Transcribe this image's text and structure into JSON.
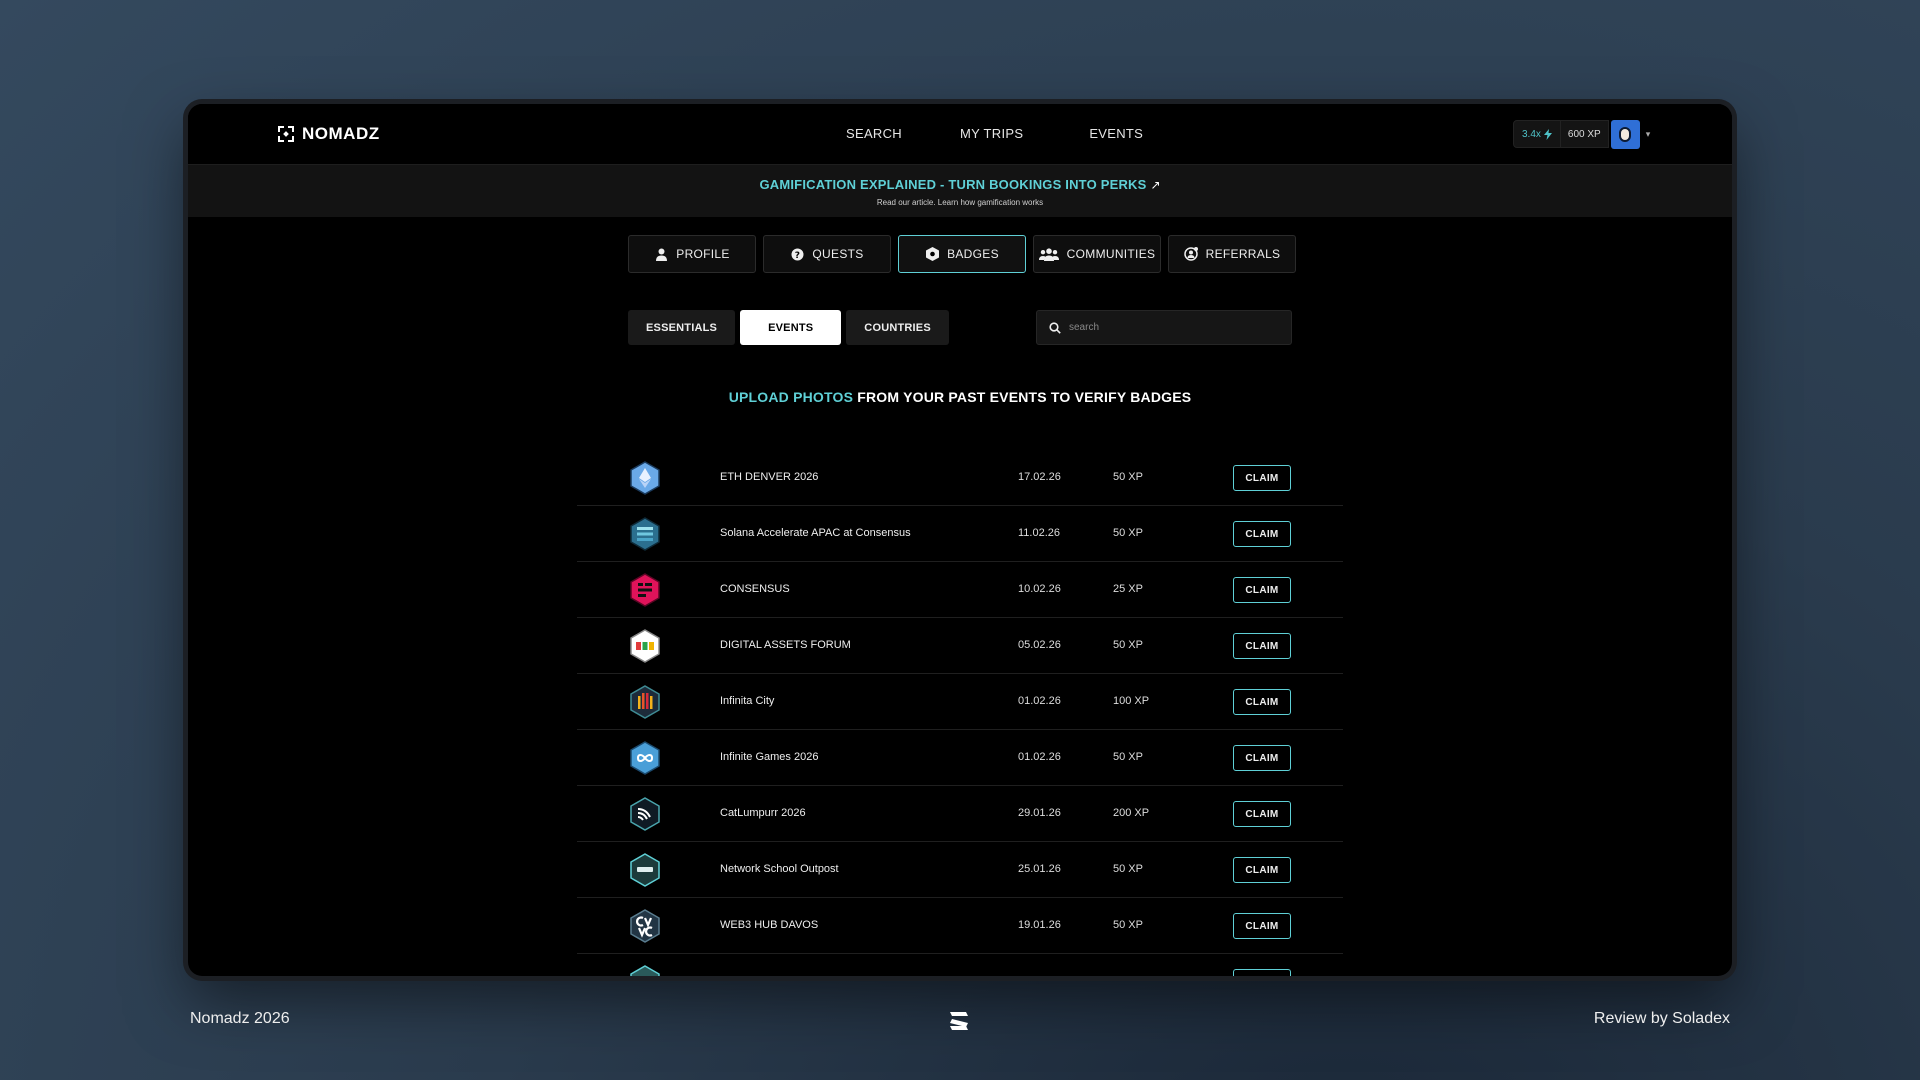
{
  "app": {
    "logo_text": "NOMADZ"
  },
  "nav": {
    "items": [
      {
        "label": "SEARCH"
      },
      {
        "label": "MY TRIPS"
      },
      {
        "label": "EVENTS"
      }
    ]
  },
  "user": {
    "multiplier": "3.4x",
    "xp": "600 XP"
  },
  "banner": {
    "title": "GAMIFICATION EXPLAINED - TURN BOOKINGS INTO PERKS",
    "subtitle": "Read our article. Learn how gamification works"
  },
  "tabs": [
    {
      "label": "PROFILE",
      "icon": "person-icon",
      "active": false
    },
    {
      "label": "QUESTS",
      "icon": "quest-icon",
      "active": false
    },
    {
      "label": "BADGES",
      "icon": "badge-icon",
      "active": true
    },
    {
      "label": "COMMUNITIES",
      "icon": "users-icon",
      "active": false
    },
    {
      "label": "REFERRALS",
      "icon": "referral-icon",
      "active": false
    }
  ],
  "subtabs": [
    {
      "label": "ESSENTIALS",
      "active": false
    },
    {
      "label": "EVENTS",
      "active": true
    },
    {
      "label": "COUNTRIES",
      "active": false
    }
  ],
  "search": {
    "placeholder": "search"
  },
  "headline": {
    "accent": "UPLOAD PHOTOS",
    "rest": " FROM YOUR PAST EVENTS TO VERIFY BADGES"
  },
  "events": [
    {
      "name": "ETH DENVER 2026",
      "date": "17.02.26",
      "xp": "50 XP",
      "action": "CLAIM",
      "badge_color": "#6aa9e8",
      "badge_icon": "eth-denver-badge-icon"
    },
    {
      "name": "Solana Accelerate APAC at Consensus",
      "date": "11.02.26",
      "xp": "50 XP",
      "action": "CLAIM",
      "badge_color": "#2b6f8f",
      "badge_icon": "solana-badge-icon"
    },
    {
      "name": "CONSENSUS",
      "date": "10.02.26",
      "xp": "25 XP",
      "action": "CLAIM",
      "badge_color": "#e0135a",
      "badge_icon": "consensus-badge-icon"
    },
    {
      "name": "DIGITAL ASSETS FORUM",
      "date": "05.02.26",
      "xp": "50 XP",
      "action": "CLAIM",
      "badge_color": "#ffffff",
      "badge_icon": "digital-assets-badge-icon"
    },
    {
      "name": "Infinita City",
      "date": "01.02.26",
      "xp": "100 XP",
      "action": "CLAIM",
      "badge_color": "#1d2b3a",
      "badge_icon": "infinita-badge-icon"
    },
    {
      "name": "Infinite Games 2026",
      "date": "01.02.26",
      "xp": "50 XP",
      "action": "CLAIM",
      "badge_color": "#4a9fd8",
      "badge_icon": "infinite-games-badge-icon"
    },
    {
      "name": "CatLumpurr 2026",
      "date": "29.01.26",
      "xp": "200 XP",
      "action": "CLAIM",
      "badge_color": "#0f1a24",
      "badge_icon": "catlumpurr-badge-icon"
    },
    {
      "name": "Network School Outpost",
      "date": "25.01.26",
      "xp": "50 XP",
      "action": "CLAIM",
      "badge_color": "#1c3a3a",
      "badge_icon": "network-school-badge-icon"
    },
    {
      "name": "WEB3 HUB DAVOS",
      "date": "19.01.26",
      "xp": "50 XP",
      "action": "CLAIM",
      "badge_color": "#223544",
      "badge_icon": "web3-hub-badge-icon"
    }
  ],
  "footer": {
    "left": "Nomadz 2026",
    "right": "Review by Soladex"
  }
}
